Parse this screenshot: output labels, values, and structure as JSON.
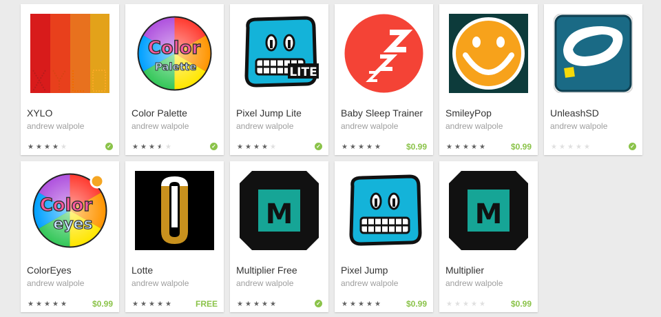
{
  "colors": {
    "price": "#8bc34a",
    "installed": "#8bc34a",
    "star_on": "#616161",
    "star_off": "#e0e0e0"
  },
  "apps": [
    {
      "title": "XYLO",
      "developer": "andrew walpole",
      "rating": 4,
      "price": "",
      "installed": true,
      "icon": "xylo-icon"
    },
    {
      "title": "Color Palette",
      "developer": "andrew walpole",
      "rating": 3.5,
      "price": "",
      "installed": true,
      "icon": "color-palette-icon"
    },
    {
      "title": "Pixel Jump Lite",
      "developer": "andrew walpole",
      "rating": 4,
      "price": "",
      "installed": true,
      "icon": "pixel-jump-lite-icon",
      "icon_badge": "LITE"
    },
    {
      "title": "Baby Sleep Trainer",
      "developer": "andrew walpole",
      "rating": 5,
      "price": "$0.99",
      "installed": false,
      "icon": "baby-sleep-icon"
    },
    {
      "title": "SmileyPop",
      "developer": "andrew walpole",
      "rating": 5,
      "price": "$0.99",
      "installed": false,
      "icon": "smileypop-icon"
    },
    {
      "title": "UnleashSD",
      "developer": "andrew walpole",
      "rating": 0,
      "price": "",
      "installed": true,
      "icon": "unleashsd-icon"
    },
    {
      "title": "ColorEyes",
      "developer": "andrew walpole",
      "rating": 5,
      "price": "$0.99",
      "installed": false,
      "icon": "coloreyes-icon"
    },
    {
      "title": "Lotte",
      "developer": "andrew walpole",
      "rating": 5,
      "price": "FREE",
      "installed": false,
      "icon": "lotte-icon"
    },
    {
      "title": "Multiplier Free",
      "developer": "andrew walpole",
      "rating": 5,
      "price": "",
      "installed": true,
      "icon": "multiplier-free-icon"
    },
    {
      "title": "Pixel Jump",
      "developer": "andrew walpole",
      "rating": 5,
      "price": "$0.99",
      "installed": false,
      "icon": "pixel-jump-icon"
    },
    {
      "title": "Multiplier",
      "developer": "andrew walpole",
      "rating": 0,
      "price": "$0.99",
      "installed": false,
      "icon": "multiplier-icon"
    }
  ]
}
